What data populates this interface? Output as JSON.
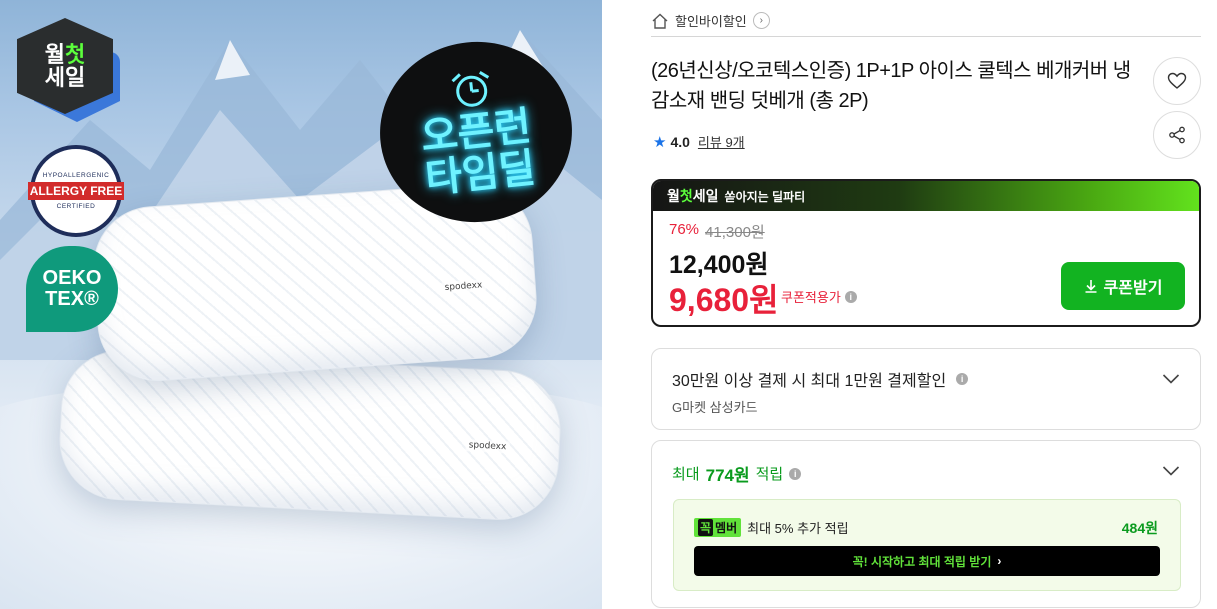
{
  "image": {
    "sale_badge": {
      "line1_pre": "월",
      "line1_hl": "첫",
      "line2": "세일"
    },
    "allergy_badge": {
      "ring_top": "HYPOALLERGENIC",
      "ribbon": "ALLERGY FREE",
      "ring_bottom": "CERTIFIED"
    },
    "oeko_badge": {
      "line1": "OEKO",
      "line2": "TEX®"
    },
    "open_badge": {
      "line1": "오픈런",
      "line2": "타임딜"
    },
    "pillow_tag": "spodexx"
  },
  "breadcrumb": {
    "shop_name": "할인바이할인"
  },
  "product": {
    "title": "(26년신상/오코텍스인증) 1P+1P 아이스 쿨텍스 베개커버 냉감소재 밴딩 덧베개 (총 2P)",
    "rating": "4.0",
    "reviews": "리뷰 9개"
  },
  "deal": {
    "brand_pre": "월",
    "brand_hl": "첫",
    "brand_post": "세일",
    "subtitle": "쏟아지는 딜파티",
    "discount_rate": "76%",
    "original_price": "41,300원",
    "sale_price": "12,400원",
    "coupon_price": "9,680원",
    "coupon_label": "쿠폰적용가",
    "coupon_button": "쿠폰받기"
  },
  "card_discount": {
    "title": "30만원 이상 결제 시 최대 1만원 결제할인",
    "subtitle": "G마켓 삼성카드"
  },
  "points": {
    "prefix": "최대",
    "amount": "774원",
    "suffix": "적립",
    "member_tag_a": "꼭",
    "member_tag_b": "멤버",
    "member_text": "최대 5% 추가 적립",
    "member_points": "484원",
    "member_button": "꼭! 시작하고 최대 적립 받기"
  },
  "colors": {
    "accent_green": "#12b321",
    "price_red": "#e8213a",
    "star_blue": "#1a73e8"
  }
}
